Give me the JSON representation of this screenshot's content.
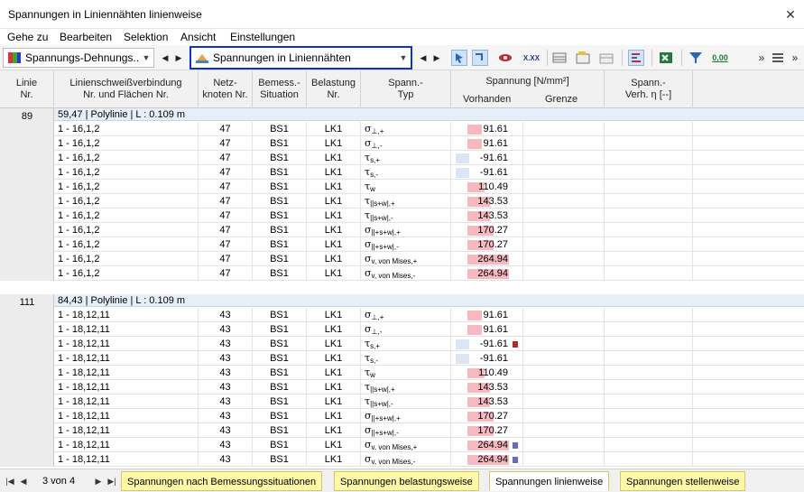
{
  "window": {
    "title": "Spannungen in Liniennähten linienweise",
    "close_glyph": "✕"
  },
  "menu": [
    "Gehe zu",
    "Bearbeiten",
    "Selektion",
    "Ansicht",
    "Einstellungen"
  ],
  "toolbar": {
    "combo1": "Spannungs-Dehnungs...",
    "combo2": "Spannungen in Liniennähten",
    "zero_label": "0,00",
    "xxx_label": "X.XX"
  },
  "header": {
    "linie": [
      "Linie",
      "Nr."
    ],
    "verbindung": [
      "Linienschweißverbindung",
      "Nr. und Flächen Nr."
    ],
    "netz": [
      "Netz-",
      "knoten Nr."
    ],
    "bemess": [
      "Bemess.-",
      "Situation"
    ],
    "belastung": [
      "Belastung",
      "Nr."
    ],
    "spanntyp": [
      "Spann.-",
      "Typ"
    ],
    "spannung": "Spannung [N/mm²]",
    "vorhanden": "Vorhanden",
    "grenze": "Grenze",
    "verh": [
      "Spann.-",
      "Verh. η [--]"
    ]
  },
  "groups": [
    {
      "line": "89",
      "info": "59,47 | Polylinie | L : 0.109 m",
      "rows": [
        {
          "conn": "1 - 16,1,2",
          "knot": "47",
          "bs": "BS1",
          "lk": "LK1",
          "sym": "σ",
          "sub": "⊥,+",
          "val": "91.61",
          "frac": 0.35
        },
        {
          "conn": "1 - 16,1,2",
          "knot": "47",
          "bs": "BS1",
          "lk": "LK1",
          "sym": "σ",
          "sub": "⊥,-",
          "val": "91.61",
          "frac": 0.35
        },
        {
          "conn": "1 - 16,1,2",
          "knot": "47",
          "bs": "BS1",
          "lk": "LK1",
          "sym": "τ",
          "sub": "s,+",
          "val": "-91.61",
          "frac": -0.35
        },
        {
          "conn": "1 - 16,1,2",
          "knot": "47",
          "bs": "BS1",
          "lk": "LK1",
          "sym": "τ",
          "sub": "s,-",
          "val": "-91.61",
          "frac": -0.35
        },
        {
          "conn": "1 - 16,1,2",
          "knot": "47",
          "bs": "BS1",
          "lk": "LK1",
          "sym": "τ",
          "sub": "w",
          "val": "110.49",
          "frac": 0.42
        },
        {
          "conn": "1 - 16,1,2",
          "knot": "47",
          "bs": "BS1",
          "lk": "LK1",
          "sym": "τ",
          "sub": "||s+w|,+",
          "val": "143.53",
          "frac": 0.54
        },
        {
          "conn": "1 - 16,1,2",
          "knot": "47",
          "bs": "BS1",
          "lk": "LK1",
          "sym": "τ",
          "sub": "||s+w|,-",
          "val": "143.53",
          "frac": 0.54
        },
        {
          "conn": "1 - 16,1,2",
          "knot": "47",
          "bs": "BS1",
          "lk": "LK1",
          "sym": "σ",
          "sub": "||+s+w|,+",
          "val": "170.27",
          "frac": 0.64
        },
        {
          "conn": "1 - 16,1,2",
          "knot": "47",
          "bs": "BS1",
          "lk": "LK1",
          "sym": "σ",
          "sub": "||+s+w|,-",
          "val": "170.27",
          "frac": 0.64
        },
        {
          "conn": "1 - 16,1,2",
          "knot": "47",
          "bs": "BS1",
          "lk": "LK1",
          "sym": "σ",
          "sub": "v, von Mises,+",
          "val": "264.94",
          "frac": 1.0
        },
        {
          "conn": "1 - 16,1,2",
          "knot": "47",
          "bs": "BS1",
          "lk": "LK1",
          "sym": "σ",
          "sub": "v, von Mises,-",
          "val": "264.94",
          "frac": 1.0
        }
      ]
    },
    {
      "line": "111",
      "info": "84,43 | Polylinie | L : 0.109 m",
      "rows": [
        {
          "conn": "1 - 18,12,11",
          "knot": "43",
          "bs": "BS1",
          "lk": "LK1",
          "sym": "σ",
          "sub": "⊥,+",
          "val": "91.61",
          "frac": 0.35
        },
        {
          "conn": "1 - 18,12,11",
          "knot": "43",
          "bs": "BS1",
          "lk": "LK1",
          "sym": "σ",
          "sub": "⊥,-",
          "val": "91.61",
          "frac": 0.35
        },
        {
          "conn": "1 - 18,12,11",
          "knot": "43",
          "bs": "BS1",
          "lk": "LK1",
          "sym": "τ",
          "sub": "s,+",
          "val": "-91.61",
          "frac": -0.35,
          "mark": "#b02a2a"
        },
        {
          "conn": "1 - 18,12,11",
          "knot": "43",
          "bs": "BS1",
          "lk": "LK1",
          "sym": "τ",
          "sub": "s,-",
          "val": "-91.61",
          "frac": -0.35
        },
        {
          "conn": "1 - 18,12,11",
          "knot": "43",
          "bs": "BS1",
          "lk": "LK1",
          "sym": "τ",
          "sub": "w",
          "val": "110.49",
          "frac": 0.42
        },
        {
          "conn": "1 - 18,12,11",
          "knot": "43",
          "bs": "BS1",
          "lk": "LK1",
          "sym": "τ",
          "sub": "||s+w|,+",
          "val": "143.53",
          "frac": 0.54
        },
        {
          "conn": "1 - 18,12,11",
          "knot": "43",
          "bs": "BS1",
          "lk": "LK1",
          "sym": "τ",
          "sub": "||s+w|,-",
          "val": "143.53",
          "frac": 0.54
        },
        {
          "conn": "1 - 18,12,11",
          "knot": "43",
          "bs": "BS1",
          "lk": "LK1",
          "sym": "σ",
          "sub": "||+s+w|,+",
          "val": "170.27",
          "frac": 0.64
        },
        {
          "conn": "1 - 18,12,11",
          "knot": "43",
          "bs": "BS1",
          "lk": "LK1",
          "sym": "σ",
          "sub": "||+s+w|,-",
          "val": "170.27",
          "frac": 0.64
        },
        {
          "conn": "1 - 18,12,11",
          "knot": "43",
          "bs": "BS1",
          "lk": "LK1",
          "sym": "σ",
          "sub": "v, von Mises,+",
          "val": "264.94",
          "frac": 1.0,
          "mark": "#6a6ab8"
        },
        {
          "conn": "1 - 18,12,11",
          "knot": "43",
          "bs": "BS1",
          "lk": "LK1",
          "sym": "σ",
          "sub": "v, von Mises,-",
          "val": "264.94",
          "frac": 1.0,
          "mark": "#6a6ab8"
        }
      ]
    }
  ],
  "footer": {
    "page_info": "3 von 4",
    "tabs": [
      "Spannungen nach Bemessungssituationen",
      "Spannungen belastungsweise",
      "Spannungen linienweise",
      "Spannungen stellenweise"
    ],
    "active_tab": 2
  }
}
